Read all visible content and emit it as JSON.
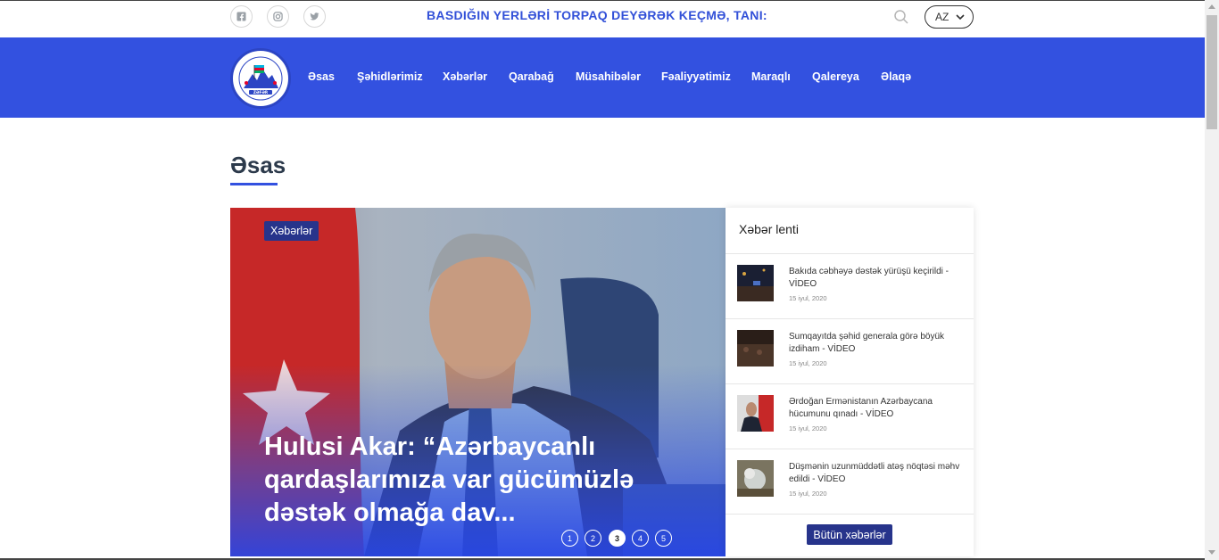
{
  "topbar": {
    "social": [
      {
        "icon": "facebook-icon"
      },
      {
        "icon": "instagram-icon"
      },
      {
        "icon": "twitter-icon"
      }
    ],
    "ticker_text": "BASDIĞIN YERLƏRİ TORPAQ DEYƏRƏK KEÇMƏ, TANI:",
    "search_icon": "search-icon",
    "language": "AZ"
  },
  "logo": {
    "text_top": "Şəhid Ailələrinə Dəstək",
    "text_bottom": "İctimai Birliyi",
    "brand": "ZƏFƏR"
  },
  "nav": {
    "items": [
      "Əsas",
      "Şəhidlərimiz",
      "Xəbərlər",
      "Qarabağ",
      "Müsahibələr",
      "Fəaliyyətimiz",
      "Maraqlı",
      "Qalereya",
      "Əlaqə"
    ]
  },
  "main": {
    "section_title": "Əsas"
  },
  "slider": {
    "category": "Xəbərlər",
    "title": "Hulusi Akar: “Azərbaycanlı qardaşlarımıza var gücümüzlə dəstək olmağa dav...",
    "dots": [
      "1",
      "2",
      "3",
      "4",
      "5"
    ],
    "active_dot": 3
  },
  "feed": {
    "title": "Xəbər lenti",
    "items": [
      {
        "text": "Bakıda cəbhəyə dəstək yürüşü keçirildi - VİDEO",
        "date": "15 iyul, 2020"
      },
      {
        "text": "Sumqayıtda şəhid generala görə böyük izdiham - VİDEO",
        "date": "15 iyul, 2020"
      },
      {
        "text": "Ərdoğan Ermənistanın Azərbaycana hücumunu qınadı - VİDEO",
        "date": "15 iyul, 2020"
      },
      {
        "text": "Düşmənin uzunmüddətli atəş nöqtəsi məhv edildi - VİDEO",
        "date": "15 iyul, 2020"
      }
    ],
    "all_button": "Bütün xəbərlər"
  },
  "colors": {
    "primary": "#3351e0",
    "badge": "#27348b",
    "ticker": "#3250d8"
  }
}
